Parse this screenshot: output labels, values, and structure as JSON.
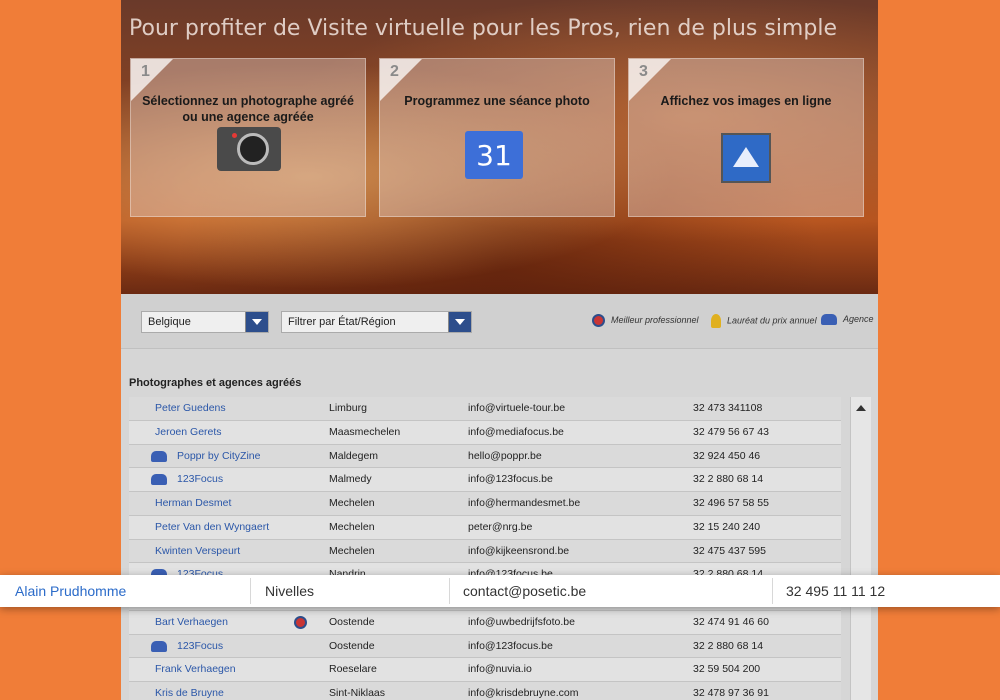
{
  "hero": {
    "title": "Pour profiter de Visite virtuelle pour les Pros, rien de plus simple",
    "steps": [
      {
        "num": "1",
        "text": "Sélectionnez un photographe agréé ou une agence agréée",
        "icon": "camera-icon"
      },
      {
        "num": "2",
        "text": "Programmez une séance photo",
        "icon": "calendar-icon",
        "icon_text": "31"
      },
      {
        "num": "3",
        "text": "Affichez vos images en ligne",
        "icon": "image-icon"
      }
    ]
  },
  "filters": {
    "country": "Belgique",
    "region": "Filtrer par État/Région",
    "legend": {
      "best": "Meilleur professionnel",
      "laureate": "Lauréat du prix annuel",
      "agency": "Agence"
    }
  },
  "list": {
    "title": "Photographes et agences agréés",
    "rows": [
      {
        "name": "Peter Guedens",
        "city": "Limburg",
        "email": "info@virtuele-tour.be",
        "phone": "32 473 341108",
        "agency": false
      },
      {
        "name": "Jeroen Gerets",
        "city": "Maasmechelen",
        "email": "info@mediafocus.be",
        "phone": "32 479 56 67 43",
        "agency": false
      },
      {
        "name": "Poppr by CityZine",
        "city": "Maldegem",
        "email": "hello@poppr.be",
        "phone": "32 924 450 46",
        "agency": true
      },
      {
        "name": "123Focus",
        "city": "Malmedy",
        "email": "info@123focus.be",
        "phone": "32 2 880 68 14",
        "agency": true
      },
      {
        "name": "Herman Desmet",
        "city": "Mechelen",
        "email": "info@hermandesmet.be",
        "phone": "32 496 57 58 55",
        "agency": false
      },
      {
        "name": "Peter Van den Wyngaert",
        "city": "Mechelen",
        "email": "peter@nrg.be",
        "phone": "32 15 240 240",
        "agency": false
      },
      {
        "name": "Kwinten Verspeurt",
        "city": "Mechelen",
        "email": "info@kijkeensrond.be",
        "phone": "32 475 437 595",
        "agency": false
      },
      {
        "name": "123Focus",
        "city": "Nandrin",
        "email": "info@123focus.be",
        "phone": "32 2 880 68 14",
        "agency": true
      },
      {
        "name": "",
        "city": "",
        "email": "",
        "phone": "",
        "agency": false
      },
      {
        "name": "Bart Verhaegen",
        "city": "Oostende",
        "email": "info@uwbedrijfsfoto.be",
        "phone": "32 474 91 46 60",
        "agency": false,
        "best": true
      },
      {
        "name": "123Focus",
        "city": "Oostende",
        "email": "info@123focus.be",
        "phone": "32 2 880 68 14",
        "agency": true
      },
      {
        "name": "Frank Verhaegen",
        "city": "Roeselare",
        "email": "info@nuvia.io",
        "phone": "32 59 504 200",
        "agency": false
      },
      {
        "name": "Kris de Bruyne",
        "city": "Sint-Niklaas",
        "email": "info@krisdebruyne.com",
        "phone": "32 478 97 36 91",
        "agency": false
      }
    ]
  },
  "highlight": {
    "name": "Alain Prudhomme",
    "city": "Nivelles",
    "email": "contact@posetic.be",
    "phone": "32 495 11 11 12"
  }
}
